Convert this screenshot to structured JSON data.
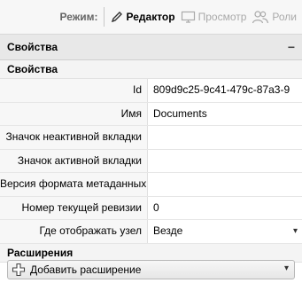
{
  "toolbar": {
    "mode_label": "Режим:",
    "modes": [
      {
        "label": "Редактор",
        "icon": "pencil-icon",
        "active": true
      },
      {
        "label": "Просмотр",
        "icon": "monitor-icon",
        "active": false
      },
      {
        "label": "Роли",
        "icon": "users-icon",
        "active": false
      }
    ]
  },
  "panel": {
    "title": "Свойства",
    "collapse_symbol": "−",
    "section_title": "Свойства",
    "properties": [
      {
        "label": "Id",
        "value": "809d9c25-9c41-479c-87a3-9"
      },
      {
        "label": "Имя",
        "value": "Documents"
      },
      {
        "label": "Значок неактивной вкладки",
        "value": ""
      },
      {
        "label": "Значок активной вкладки",
        "value": ""
      },
      {
        "label": "Версия формата метаданных",
        "value": ""
      },
      {
        "label": "Номер текущей ревизии",
        "value": "0"
      },
      {
        "label": "Где отображать узел",
        "value": "Везде"
      }
    ],
    "extensions_title": "Расширения",
    "add_extension_label": "Добавить расширение"
  }
}
